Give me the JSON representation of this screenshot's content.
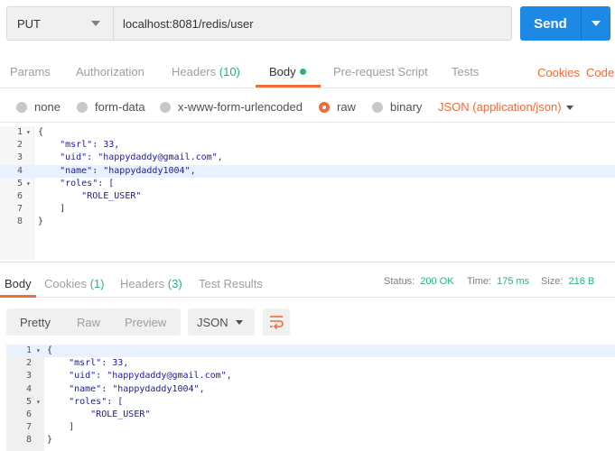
{
  "request": {
    "method": "PUT",
    "url": "localhost:8081/redis/user",
    "send_label": "Send"
  },
  "request_tabs": {
    "params": "Params",
    "authorization": "Authorization",
    "headers": "Headers",
    "headers_count": "(10)",
    "body": "Body",
    "prerequest": "Pre-request Script",
    "tests": "Tests",
    "cookies": "Cookies",
    "code": "Code"
  },
  "body_types": {
    "none": "none",
    "form_data": "form-data",
    "urlencoded": "x-www-form-urlencoded",
    "raw": "raw",
    "binary": "binary",
    "json_type": "JSON (application/json)"
  },
  "request_body": {
    "lines": [
      "{",
      "    \"msrl\": 33,",
      "    \"uid\": \"happydaddy@gmail.com\",",
      "    \"name\": \"happydaddy1004\",",
      "    \"roles\": [",
      "        \"ROLE_USER\"",
      "    ]",
      "}"
    ],
    "numbers": [
      "1",
      "2",
      "3",
      "4",
      "5",
      "6",
      "7",
      "8"
    ]
  },
  "response_tabs": {
    "body": "Body",
    "cookies": "Cookies",
    "cookies_count": "(1)",
    "headers": "Headers",
    "headers_count": "(3)",
    "test_results": "Test Results"
  },
  "response_status": {
    "status_label": "Status:",
    "status_value": "200 OK",
    "time_label": "Time:",
    "time_value": "175 ms",
    "size_label": "Size:",
    "size_value": "216 B"
  },
  "response_view": {
    "pretty": "Pretty",
    "raw": "Raw",
    "preview": "Preview",
    "format": "JSON"
  },
  "response_body": {
    "lines": [
      "{",
      "    \"msrl\": 33,",
      "    \"uid\": \"happydaddy@gmail.com\",",
      "    \"name\": \"happydaddy1004\",",
      "    \"roles\": [",
      "        \"ROLE_USER\"",
      "    ]",
      "}"
    ],
    "numbers": [
      "1",
      "2",
      "3",
      "4",
      "5",
      "6",
      "7",
      "8"
    ]
  },
  "colors": {
    "accent": "#f26b3a",
    "send": "#1e88e5",
    "success": "#26b47f"
  }
}
